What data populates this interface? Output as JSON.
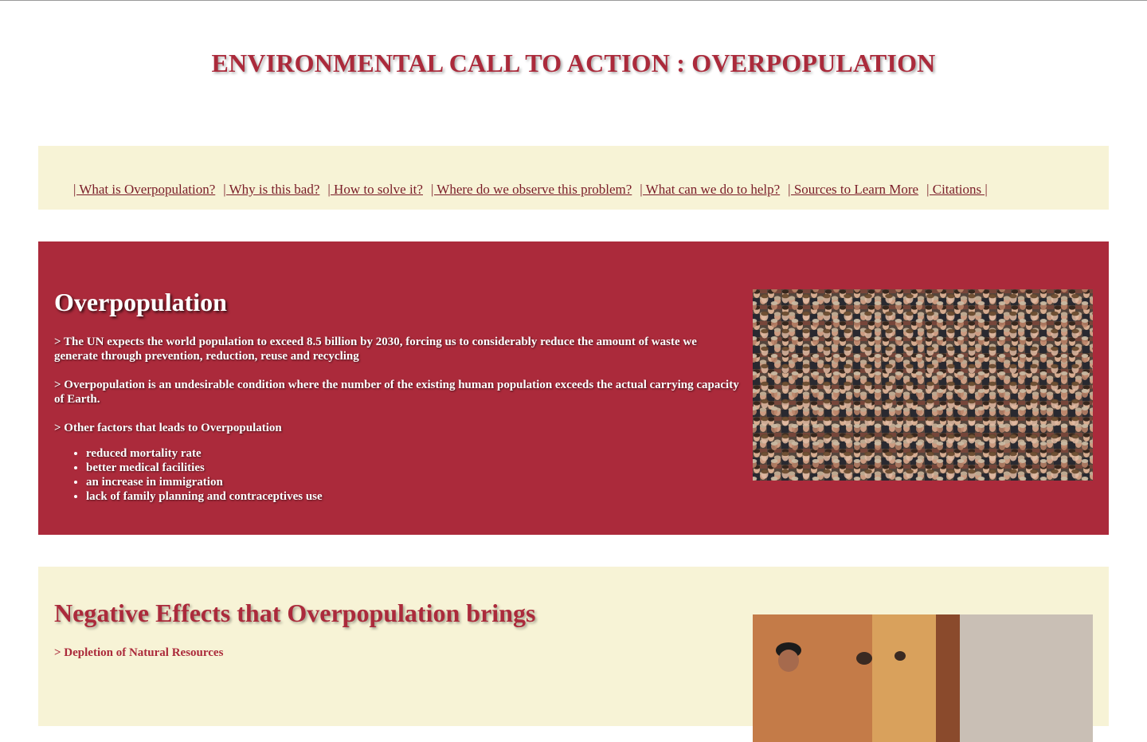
{
  "header": {
    "title": "ENVIRONMENTAL CALL TO ACTION : OVERPOPULATION"
  },
  "nav": {
    "links": [
      "| What is Overpopulation?",
      "| Why is this bad?",
      "| How to solve it?",
      "| Where do we observe this problem?",
      "| What can we do to help?",
      "| Sources to Learn More",
      "| Citations |"
    ]
  },
  "overpopulation": {
    "heading": "Overpopulation",
    "p1": "> The UN expects the world population to exceed 8.5 billion by 2030, forcing us to considerably reduce the amount of waste we generate through prevention, reduction, reuse and recycling",
    "p2": "> Overpopulation is an undesirable condition where the number of the existing human population exceeds the actual carrying capacity of Earth.",
    "p3": "> Other factors that leads to Overpopulation",
    "factors": [
      "reduced mortality rate",
      "better medical facilities",
      "an increase in immigration",
      "lack of family planning and contraceptives use"
    ],
    "image": "crowd-photo"
  },
  "negative_effects": {
    "heading": "Negative Effects that Overpopulation brings",
    "p1": "> Depletion of Natural Resources",
    "image": "street-photo"
  },
  "colors": {
    "accent": "#ab2a3b",
    "cream": "#f7f3d6",
    "link": "#7a1d28"
  }
}
